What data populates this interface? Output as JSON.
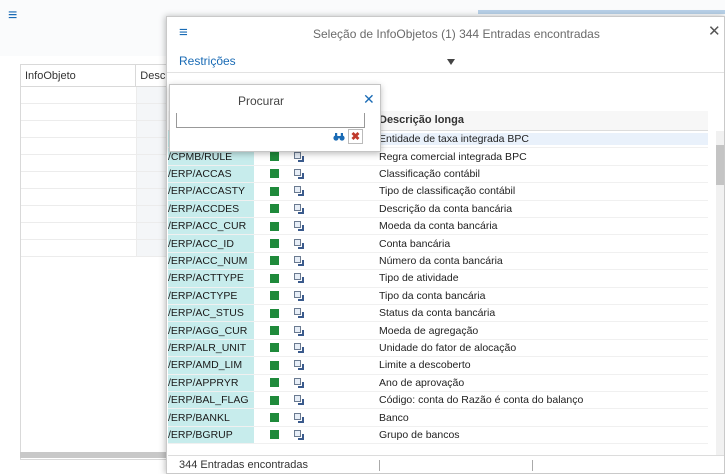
{
  "background": {
    "col_infoobjeto": "InfoObjeto",
    "col_descr": "Descr"
  },
  "dialog": {
    "title": "Seleção de InfoObjetos (1)  344 Entradas encontradas",
    "restrictions_link": "Restrições",
    "column_desc_header": "Descrição longa",
    "footer_count": "344 Entradas encontradas"
  },
  "find_popup": {
    "title": "Procurar",
    "input_value": "",
    "search_icon": "binoculars-icon",
    "clear_icon": "clear-x-icon"
  },
  "rows": [
    {
      "key": "",
      "desc": "Entidade de taxa integrada BPC",
      "highlight": true
    },
    {
      "key": "/CPMB/RULE",
      "desc": "Regra comercial integrada BPC"
    },
    {
      "key": "/ERP/ACCAS",
      "desc": "Classificação contábil"
    },
    {
      "key": "/ERP/ACCASTY",
      "desc": "Tipo de classificação contábil"
    },
    {
      "key": "/ERP/ACCDES",
      "desc": "Descrição da conta bancária"
    },
    {
      "key": "/ERP/ACC_CUR",
      "desc": "Moeda da conta bancária"
    },
    {
      "key": "/ERP/ACC_ID",
      "desc": "Conta bancária"
    },
    {
      "key": "/ERP/ACC_NUM",
      "desc": "Número da conta bancária"
    },
    {
      "key": "/ERP/ACTTYPE",
      "desc": "Tipo de atividade"
    },
    {
      "key": "/ERP/ACTYPE",
      "desc": "Tipo da conta bancária"
    },
    {
      "key": "/ERP/AC_STUS",
      "desc": "Status da conta bancária"
    },
    {
      "key": "/ERP/AGG_CUR",
      "desc": "Moeda de agregação"
    },
    {
      "key": "/ERP/ALR_UNIT",
      "desc": "Unidade do fator de alocação"
    },
    {
      "key": "/ERP/AMD_LIM",
      "desc": "Limite a descoberto"
    },
    {
      "key": "/ERP/APPRYR",
      "desc": "Ano de aprovação"
    },
    {
      "key": "/ERP/BAL_FLAG",
      "desc": "Código: conta do Razão é conta do balanço"
    },
    {
      "key": "/ERP/BANKL",
      "desc": "Banco"
    },
    {
      "key": "/ERP/BGRUP",
      "desc": "Grupo de bancos"
    }
  ],
  "colors": {
    "key_bg": "#c7ecec",
    "status_green": "#1f8a3b",
    "accent_blue": "#1a6bb5"
  }
}
